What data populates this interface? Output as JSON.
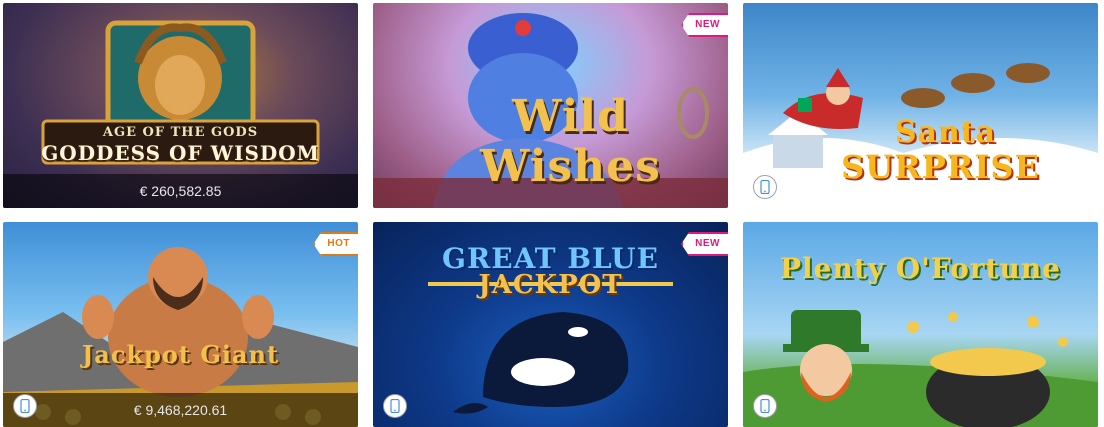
{
  "games": [
    {
      "title_line1": "AGE OF THE GODS",
      "title_line2": "GODDESS OF WISDOM",
      "jackpot": "€ 260,582.85",
      "badge": "",
      "mobile_icon": ""
    },
    {
      "title_line1": "Wild",
      "title_line2": "Wishes",
      "jackpot": "",
      "badge": "NEW",
      "mobile_icon": ""
    },
    {
      "title_line1": "Santa",
      "title_line2": "SURPRISE",
      "jackpot": "",
      "badge": "",
      "mobile_icon": "mobile-device-icon"
    },
    {
      "title_line1": "Jackpot Giant",
      "title_line2": "",
      "jackpot": "€ 9,468,220.61",
      "badge": "HOT",
      "mobile_icon": "mobile-device-icon"
    },
    {
      "title_line1": "GREAT BLUE",
      "title_line2": "JACKPOT",
      "jackpot": "",
      "badge": "NEW",
      "mobile_icon": "mobile-device-icon"
    },
    {
      "title_line1": "Plenty O'Fortune",
      "title_line2": "",
      "jackpot": "",
      "badge": "",
      "mobile_icon": "mobile-device-icon"
    }
  ],
  "colors": {
    "new_badge": "#e2197a",
    "hot_badge": "#e07a12"
  }
}
